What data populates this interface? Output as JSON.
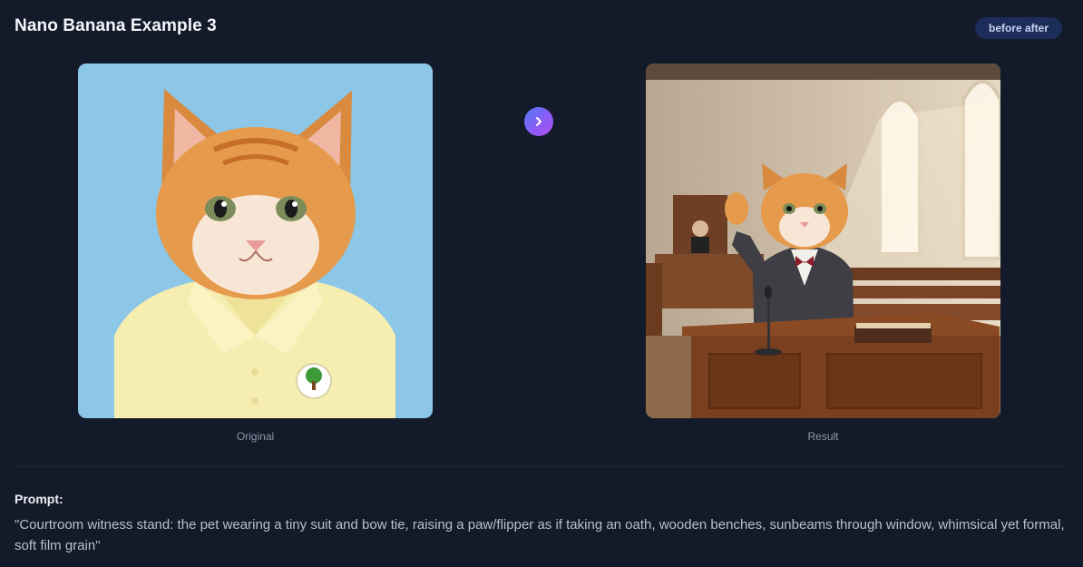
{
  "header": {
    "title": "Nano Banana Example 3",
    "toggle_label": "before after"
  },
  "images": {
    "original": {
      "caption": "Original",
      "description_icon": "kitten-photo-icon"
    },
    "result": {
      "caption": "Result",
      "description_icon": "courtroom-kitten-photo-icon"
    }
  },
  "compare_button": {
    "icon": "chevron-right-icon"
  },
  "prompt": {
    "label": "Prompt:",
    "text": "\"Courtroom witness stand: the pet wearing a tiny suit and bow tie, raising a paw/flipper as if taking an oath, wooden benches, sunbeams through window, whimsical yet formal, soft film grain\""
  },
  "colors": {
    "background": "#131a2a",
    "badge_bg": "#1d2d5a",
    "accent_gradient_start": "#4f7bf7",
    "accent_gradient_end": "#b14ef0"
  }
}
